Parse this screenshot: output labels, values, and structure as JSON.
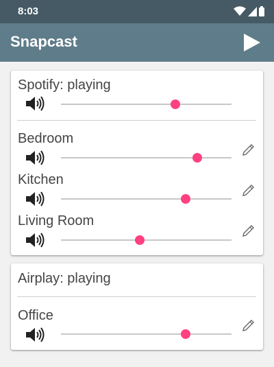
{
  "status_bar": {
    "time": "8:03",
    "icons": [
      "wifi-icon",
      "signal-icon",
      "battery-icon"
    ]
  },
  "app_bar": {
    "title": "Snapcast",
    "action_icon": "play-icon"
  },
  "colors": {
    "app_bar": "#5f7c8a",
    "status_bar": "#455a64",
    "accent": "#ff4081"
  },
  "groups": [
    {
      "stream": "Spotify: playing",
      "group_volume": 0.67,
      "clients": [
        {
          "name": "Bedroom",
          "volume": 0.8
        },
        {
          "name": "Kitchen",
          "volume": 0.73
        },
        {
          "name": "Living Room",
          "volume": 0.46
        }
      ]
    },
    {
      "stream": "Airplay: playing",
      "clients": [
        {
          "name": "Office",
          "volume": 0.73
        }
      ]
    }
  ]
}
